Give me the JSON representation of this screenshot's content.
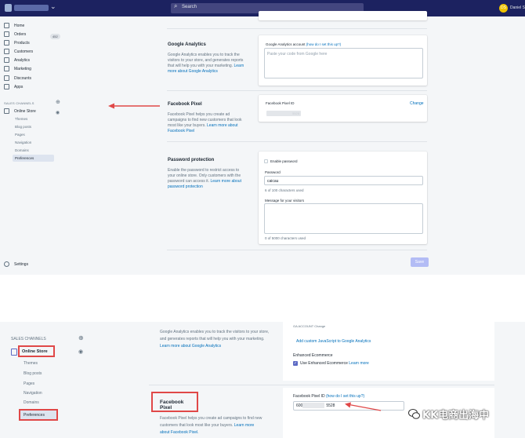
{
  "top": {
    "topbar": {
      "search_placeholder": "Search",
      "avatar_initials": "DS",
      "user_name": "Daniel S"
    },
    "sidebar": {
      "items": [
        {
          "label": "Home",
          "icon": "home-icon"
        },
        {
          "label": "Orders",
          "icon": "orders-icon",
          "badge": "452"
        },
        {
          "label": "Products",
          "icon": "tag-icon"
        },
        {
          "label": "Customers",
          "icon": "customers-icon"
        },
        {
          "label": "Analytics",
          "icon": "analytics-icon"
        },
        {
          "label": "Marketing",
          "icon": "marketing-icon"
        },
        {
          "label": "Discounts",
          "icon": "discounts-icon"
        },
        {
          "label": "Apps",
          "icon": "apps-icon"
        }
      ],
      "sales_channels_heading": "SALES CHANNELS",
      "online_store_label": "Online Store",
      "sub_items": [
        "Themes",
        "Blog posts",
        "Pages",
        "Navigation",
        "Domains",
        "Preferences"
      ],
      "settings_label": "Settings"
    },
    "google_analytics": {
      "title": "Google Analytics",
      "desc": "Google Analytics enables you to track the visitors to your store, and generates reports that will help you with your marketing.",
      "desc_link": "Learn more about Google Analytics",
      "field_label": "Google Analytics account",
      "field_link": "(how do I set this up?)",
      "placeholder": "Paste your code from Google here"
    },
    "facebook_pixel": {
      "title": "Facebook Pixel",
      "desc": "Facebook Pixel helps you create ad campaigns to find new customers that look most like your buyers.",
      "desc_link": "Learn more about Facebook Pixel",
      "field_label": "Facebook Pixel ID",
      "change_link": "Change",
      "value_suffix": "5528"
    },
    "password": {
      "title": "Password protection",
      "desc": "Enable the password to restrict access to your online store. Only customers with the password can access it.",
      "desc_link": "Learn more about password protection",
      "enable_label": "Enable password",
      "password_label": "Password",
      "password_value": "caicau",
      "password_helper": "6 of 100 characters used",
      "message_label": "Message for your visitors",
      "message_helper": "0 of 5000 characters used"
    },
    "save_label": "Save"
  },
  "bottom": {
    "sales_channels_heading": "SALES CHANNELS",
    "online_store_label": "Online Store",
    "sub_items": [
      "Themes",
      "Blog posts",
      "Pages",
      "Navigation",
      "Domains"
    ],
    "preferences_label": "Preferences",
    "ga_desc": "Google Analytics enables you to track the visitors to your store, and generates reports that will help you with your marketing.",
    "ga_desc_link": "Learn more about Google Analytics",
    "ga_top_label": "GA ACCOUNT Change",
    "add_custom_link": "Add custom JavaScript to Google Analytics",
    "enhanced_ecommerce_label": "Enhanced Ecommerce",
    "use_enhanced_label": "Use Enhanced Ecommerce",
    "use_enhanced_link": "Learn more",
    "fb_title": "Facebook Pixel",
    "fb_desc": "Facebook Pixel helps you create ad campaigns to find new customers that look most like your buyers.",
    "fb_desc_link": "Learn more about Facebook Pixel.",
    "fb_field_label": "Facebook Pixel ID",
    "fb_field_link": "(how do I set this up?)",
    "fb_value_prefix": "600",
    "fb_value_suffix": "5528"
  },
  "watermark": {
    "text": "KK电商出海中"
  },
  "colors": {
    "topbar": "#1c2260",
    "annotation_red": "#e04848",
    "link": "#006fbb",
    "save_button": "#b3bcf5"
  }
}
